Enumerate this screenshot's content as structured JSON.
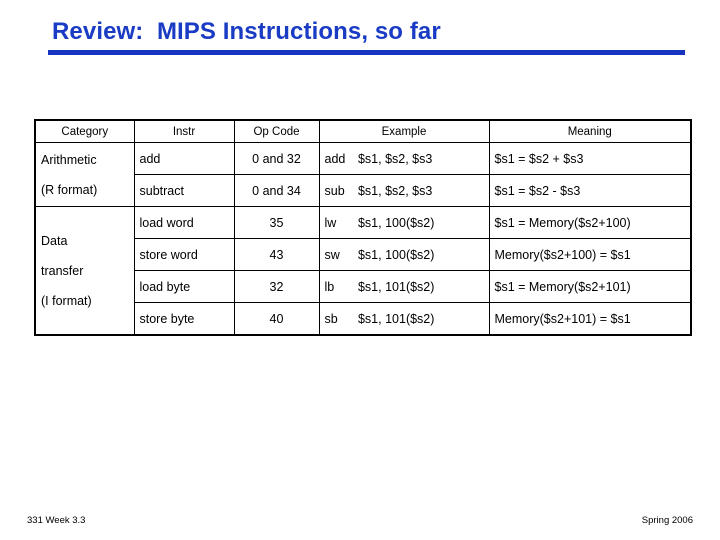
{
  "slide": {
    "title": "Review:  MIPS Instructions, so far",
    "title_color": "#1a3bc4",
    "rule_color": "#1833c0"
  },
  "table": {
    "headers": {
      "category": "Category",
      "instr": "Instr",
      "opcode": "Op Code",
      "example": "Example",
      "meaning": "Meaning"
    },
    "groups": [
      {
        "category_lines": [
          "Arithmetic",
          "(R format)"
        ],
        "rows": [
          {
            "instr": "add",
            "opcode": "0 and 32",
            "example_mnemonic": "add",
            "example_operands": "$s1, $s2, $s3",
            "meaning": "$s1 = $s2 + $s3"
          },
          {
            "instr": "subtract",
            "opcode": "0 and 34",
            "example_mnemonic": "sub",
            "example_operands": "$s1, $s2, $s3",
            "meaning": "$s1 = $s2 - $s3"
          }
        ]
      },
      {
        "category_lines": [
          "Data",
          "transfer",
          "(I format)"
        ],
        "rows": [
          {
            "instr": "load word",
            "opcode": "35",
            "example_mnemonic": "lw",
            "example_operands": "$s1, 100($s2)",
            "meaning": "$s1 = Memory($s2+100)"
          },
          {
            "instr": "store word",
            "opcode": "43",
            "example_mnemonic": "sw",
            "example_operands": "$s1, 100($s2)",
            "meaning": "Memory($s2+100) = $s1"
          },
          {
            "instr": "load byte",
            "opcode": "32",
            "example_mnemonic": "lb",
            "example_operands": "$s1, 101($s2)",
            "meaning": "$s1 = Memory($s2+101)"
          },
          {
            "instr": "store byte",
            "opcode": "40",
            "example_mnemonic": "sb",
            "example_operands": "$s1, 101($s2)",
            "meaning": "Memory($s2+101) = $s1"
          }
        ]
      }
    ]
  },
  "footer": {
    "left": "331  Week 3.3",
    "right": "Spring 2006"
  }
}
